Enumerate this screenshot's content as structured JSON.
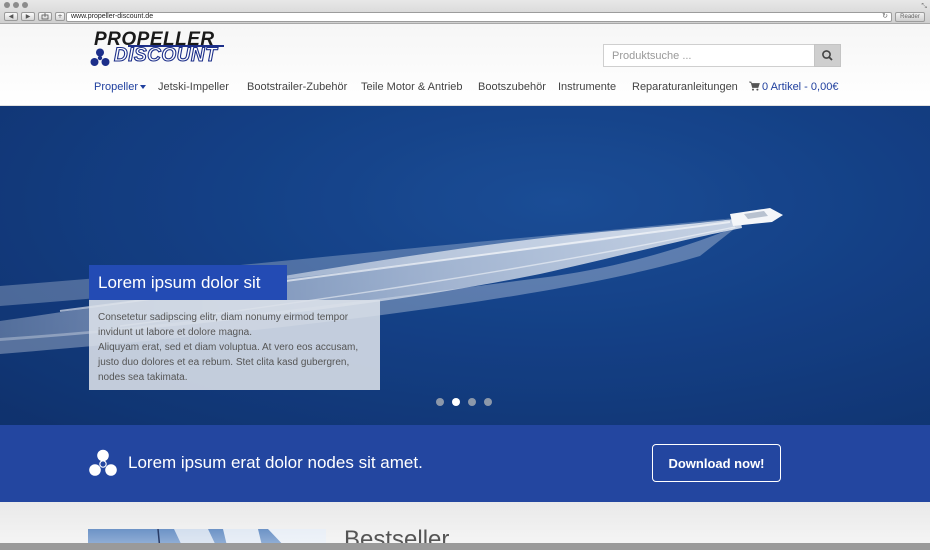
{
  "browser": {
    "url": "www.propeller-discount.de",
    "reader_label": "Reader",
    "back_glyph": "◀",
    "forward_glyph": "▶",
    "add_glyph": "+",
    "reload_glyph": "↻",
    "resize_glyph": "⤡"
  },
  "header": {
    "logo_line1": "PROPELLER",
    "logo_line2": "DISCOUNT",
    "search_placeholder": "Produktsuche ...",
    "nav": [
      {
        "label": "Propeller"
      },
      {
        "label": "Jetski-Impeller"
      },
      {
        "label": "Bootstrailer-Zubehör"
      },
      {
        "label": "Teile Motor & Antrieb"
      },
      {
        "label": "Bootszubehör"
      },
      {
        "label": "Instrumente"
      },
      {
        "label": "Reparaturanleitungen"
      }
    ],
    "cart_label": "0 Artikel - 0,00€"
  },
  "hero": {
    "title": "Lorem ipsum dolor sit",
    "text_line1": "Consetetur sadipscing elitr, diam nonumy eirmod tempor",
    "text_line2": "invidunt ut labore et dolore magna.",
    "text_line3": "Aliquyam erat, sed et diam voluptua. At vero eos accusam,",
    "text_line4": "justo duo dolores et ea rebum. Stet clita kasd gubergren,",
    "text_line5": "nodes sea takimata.",
    "slides": 4,
    "active_slide": 1
  },
  "cta": {
    "text": "Lorem ipsum erat dolor nodes sit amet.",
    "button_label": "Download now!"
  },
  "bestseller": {
    "title": "Bestseller"
  },
  "colors": {
    "brand_blue": "#2346a0",
    "nav_active": "#1f3f9e"
  }
}
